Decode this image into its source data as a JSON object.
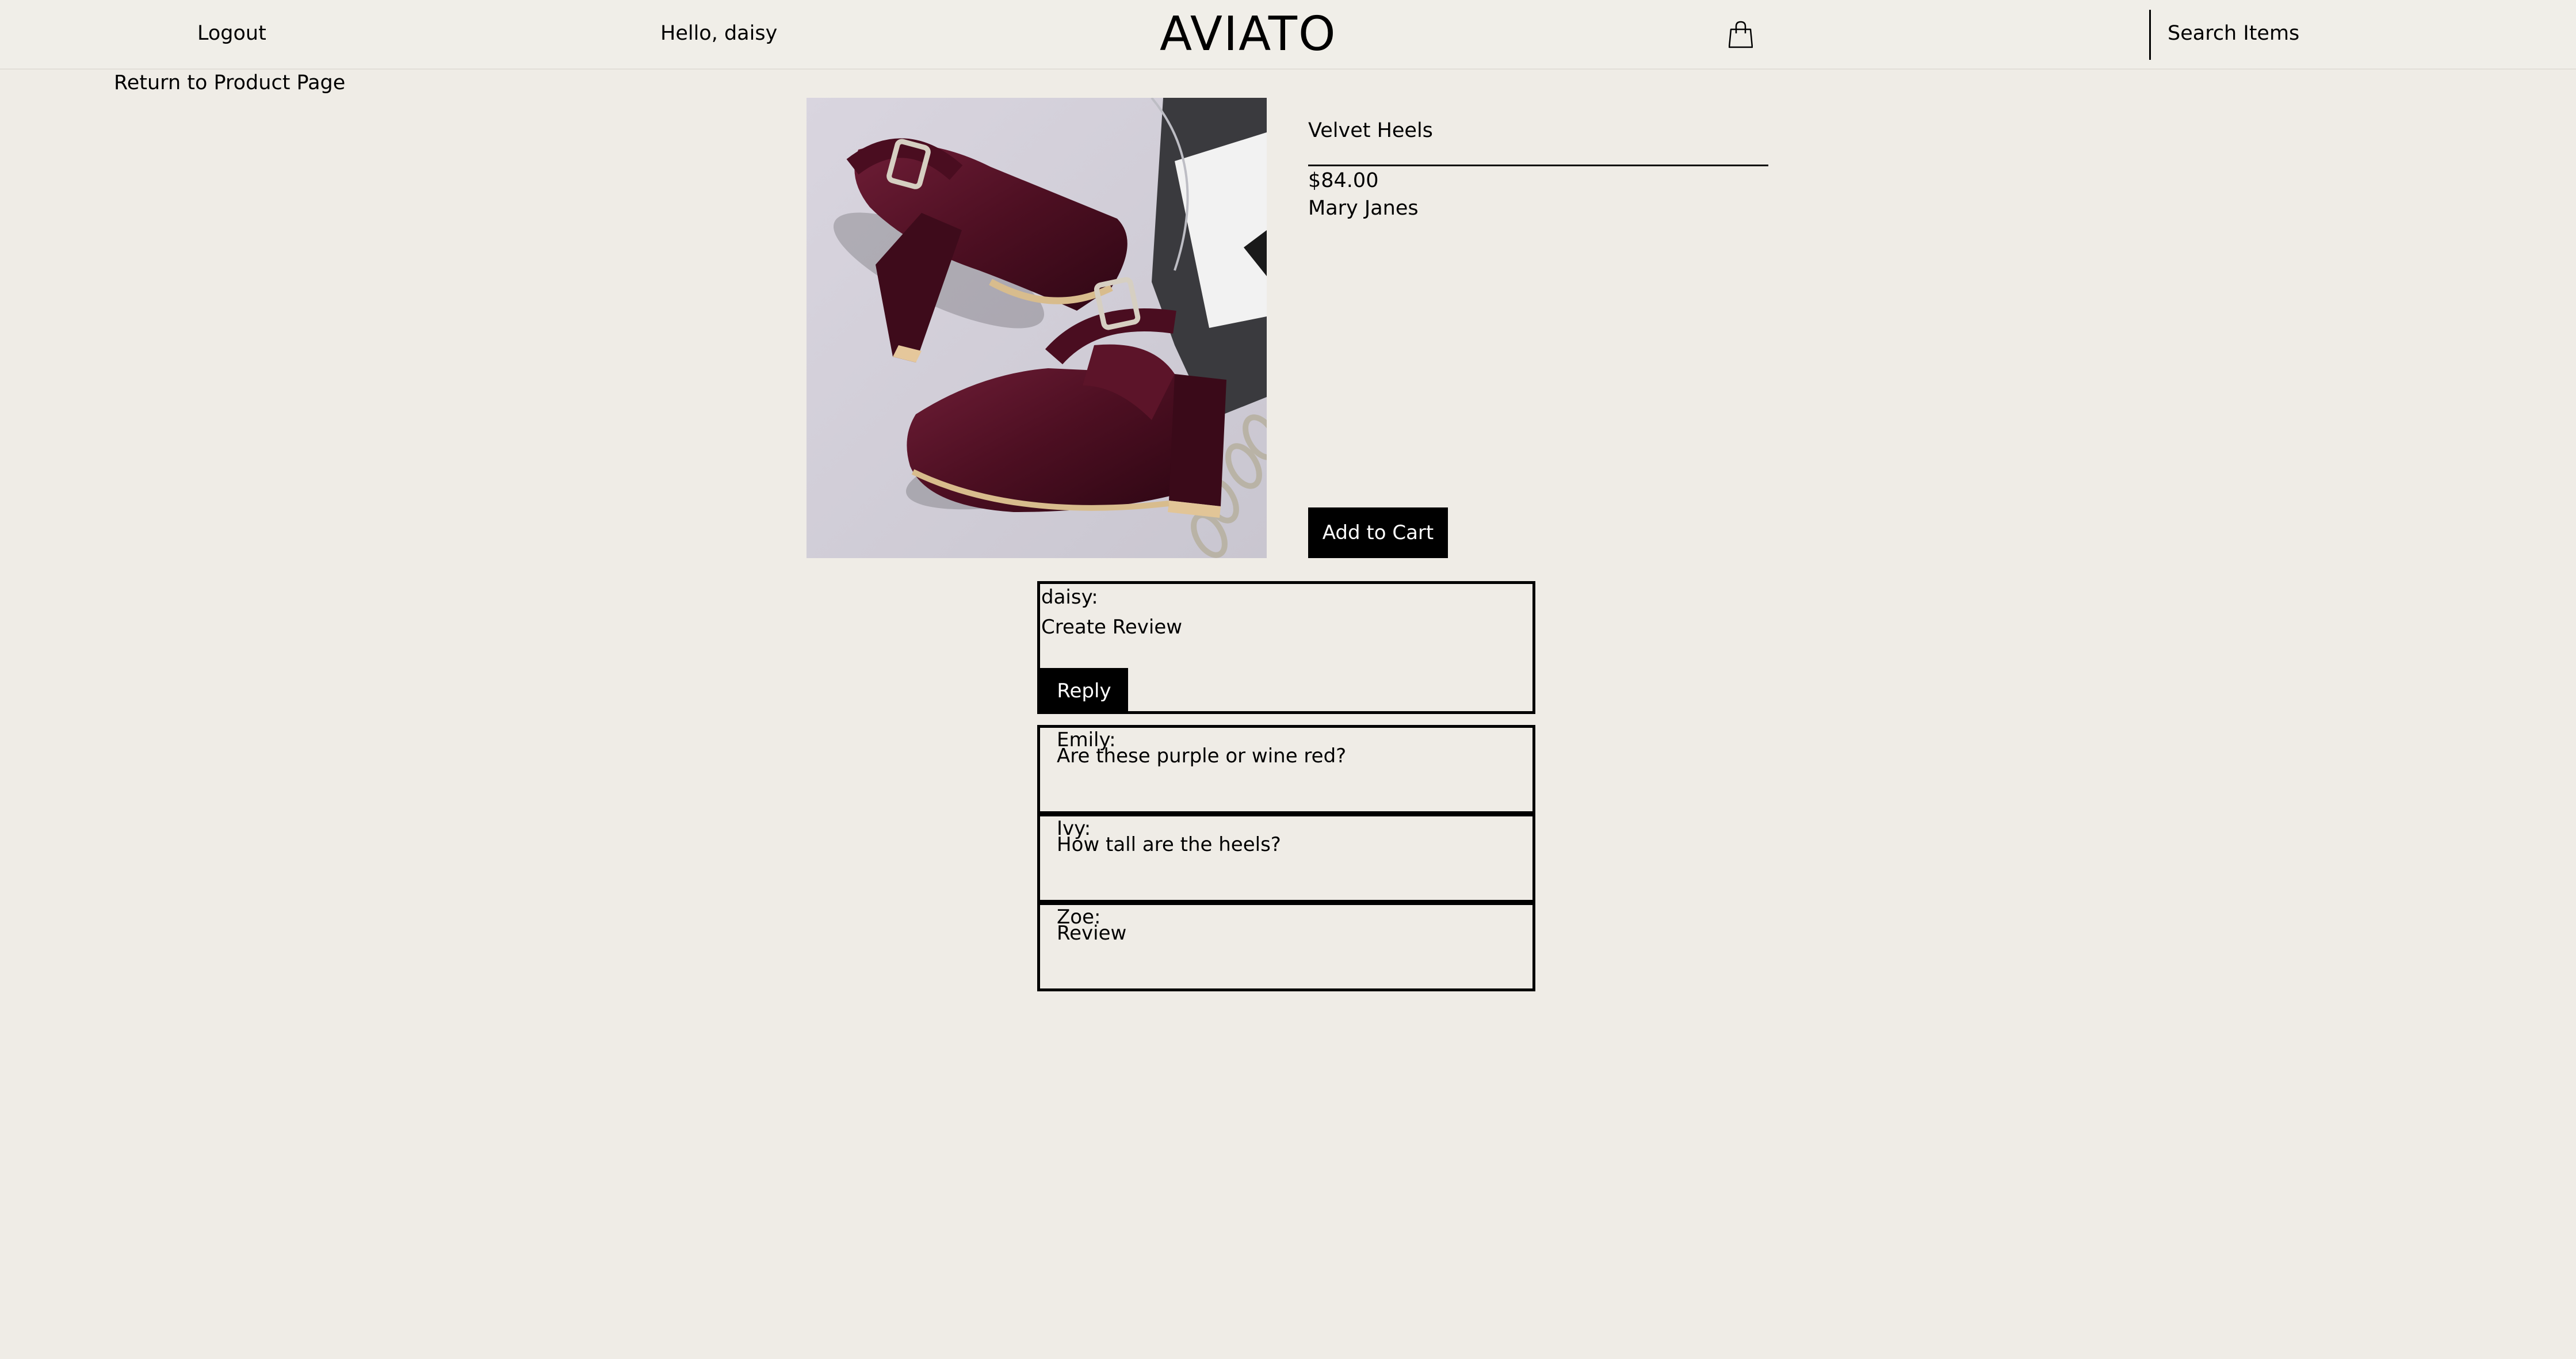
{
  "header": {
    "logout_label": "Logout",
    "greeting": "Hello, daisy",
    "logo": "AVIATO",
    "cart_icon": "shopping-bag-icon",
    "search_label": "Search Items"
  },
  "nav": {
    "return_label": "Return to Product Page"
  },
  "product": {
    "name": "Velvet Heels",
    "price": "$84.00",
    "category": "Mary Janes",
    "add_to_cart_label": "Add to Cart",
    "image_description": "burgundy-velvet-platform-heels-photo"
  },
  "review_form": {
    "user_label": "daisy:",
    "placeholder": "Create Review",
    "reply_label": "Reply"
  },
  "reviews": [
    {
      "author": "Emily:",
      "text": "Are these purple or wine red?"
    },
    {
      "author": "Ivy:",
      "text": "How tall are the heels?"
    },
    {
      "author": "Zoe:",
      "text": "Review"
    }
  ],
  "colors": {
    "background": "#efece6",
    "button": "#000000",
    "button_text": "#ffffff",
    "shoe": "#5a1428"
  }
}
